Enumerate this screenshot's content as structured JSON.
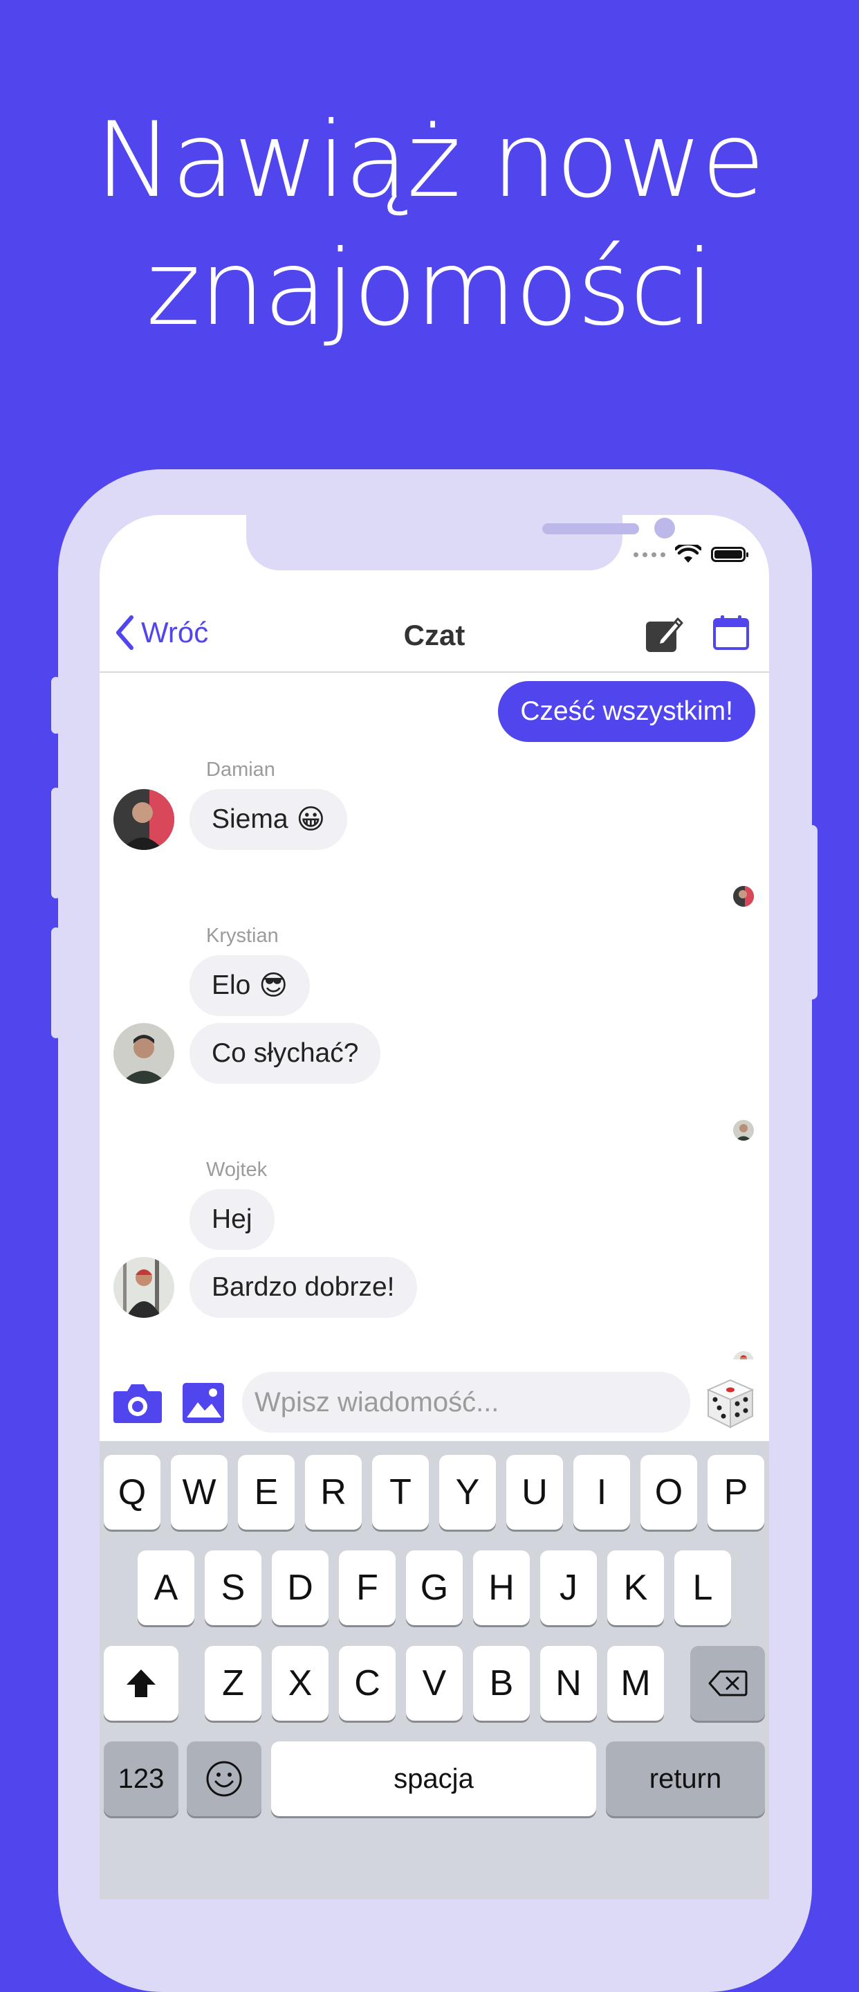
{
  "headline": {
    "line1": "Nawiąż nowe",
    "line2": "znajomości"
  },
  "colors": {
    "accent": "#5146EE",
    "frame": "#DDDAF8",
    "bubble_in": "#F0F0F5",
    "keyboard_bg": "#D2D5DB"
  },
  "navbar": {
    "back_label": "Wróć",
    "title": "Czat",
    "icons": [
      "chevron-left-icon",
      "edit-icon",
      "calendar-icon"
    ]
  },
  "chat": {
    "outgoing": {
      "text": "Cześć wszystkim!"
    },
    "groups": [
      {
        "sender": "Damian",
        "messages": [
          {
            "text": "Siema",
            "emoji": "😀"
          }
        ]
      },
      {
        "sender": "Krystian",
        "messages": [
          {
            "text": "Elo",
            "emoji": "😎"
          },
          {
            "text": "Co słychać?",
            "emoji": ""
          }
        ]
      },
      {
        "sender": "Wojtek",
        "messages": [
          {
            "text": "Hej",
            "emoji": ""
          },
          {
            "text": "Bardzo dobrze!",
            "emoji": ""
          }
        ]
      }
    ]
  },
  "composer": {
    "placeholder": "Wpisz wiadomość...",
    "icons": [
      "camera-icon",
      "image-icon",
      "dice-icon"
    ]
  },
  "keyboard": {
    "row1": [
      "Q",
      "W",
      "E",
      "R",
      "T",
      "Y",
      "U",
      "I",
      "O",
      "P"
    ],
    "row2": [
      "A",
      "S",
      "D",
      "F",
      "G",
      "H",
      "J",
      "K",
      "L"
    ],
    "row3": [
      "Z",
      "X",
      "C",
      "V",
      "B",
      "N",
      "M"
    ],
    "numbers_label": "123",
    "space_label": "spacja",
    "return_label": "return",
    "icons": [
      "shift-icon",
      "backspace-icon",
      "emoji-icon"
    ]
  }
}
